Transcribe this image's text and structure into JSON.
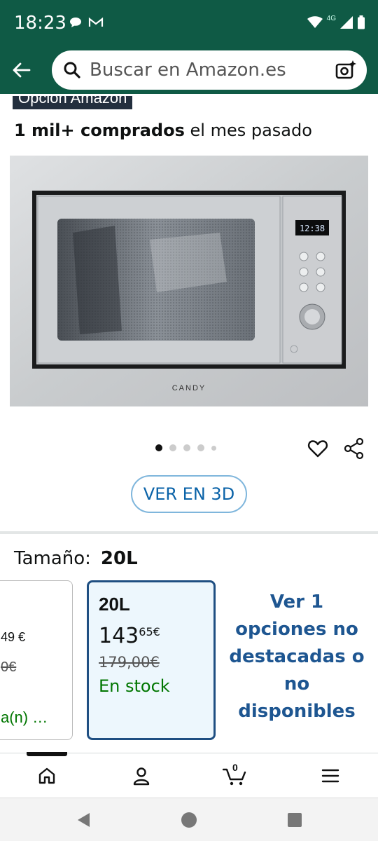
{
  "status_bar": {
    "time": "18:23",
    "network": "4G"
  },
  "header": {
    "search_placeholder": "Buscar en Amazon.es"
  },
  "badge": {
    "label": "Opción Amazon"
  },
  "social_proof": {
    "count": "1 mil+ comprados",
    "suffix": " el mes pasado"
  },
  "product_image": {
    "brand": "CANDY",
    "display_time": "12:38"
  },
  "carousel": {
    "total_dots": 5,
    "active_index": 0
  },
  "view3d": {
    "label": "VER EN 3D"
  },
  "size_selector": {
    "label": "Tamaño:",
    "selected": "20L",
    "prev_option": {
      "price": "49 €",
      "old_price": "0€",
      "stock": "a(n) …"
    },
    "option": {
      "size": "20L",
      "price_whole": "143",
      "price_fraction": "65",
      "currency": "€",
      "old_price": "179,00€",
      "stock": "En stock"
    },
    "more_options": "Ver 1 opciones no destacadas o no disponibles"
  },
  "bottom_nav": {
    "cart_count": "0"
  },
  "colors": {
    "header_bg": "#0f5a45",
    "link_blue": "#0b63a8",
    "stock_green": "#007600",
    "selected_border": "#1f4f82"
  }
}
